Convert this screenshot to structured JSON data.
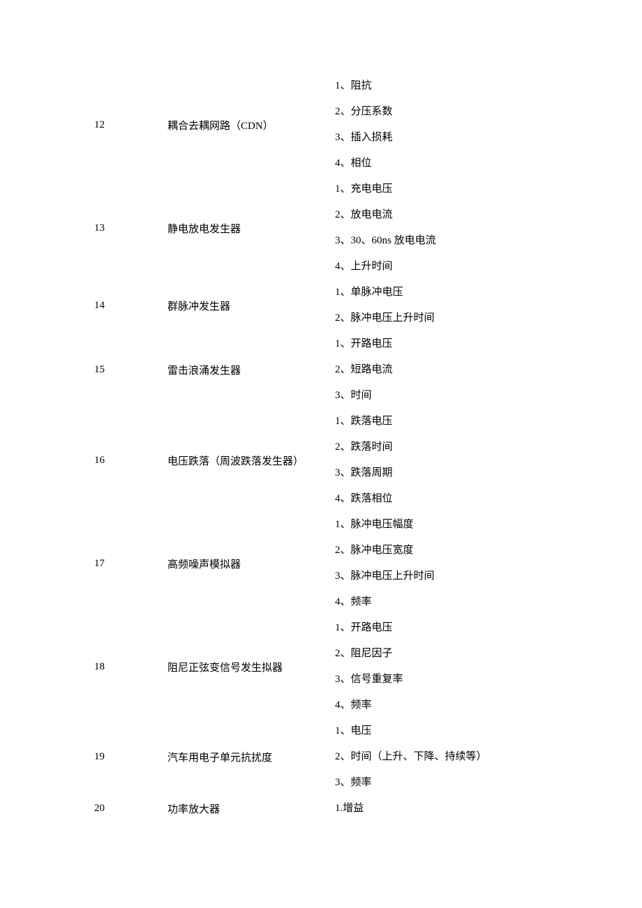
{
  "rows": [
    {
      "index": "12",
      "name": "耦合去耦网路（CDN）",
      "params": [
        "1、阻抗",
        "2、分压系数",
        "3、插入损耗",
        "4、相位"
      ]
    },
    {
      "index": "13",
      "name": "静电放电发生器",
      "params": [
        "1、充电电压",
        "2、放电电流",
        "3、30、60ns 放电电流",
        "4、上升时间"
      ]
    },
    {
      "index": "14",
      "name": "群脉冲发生器",
      "params": [
        "1、单脉冲电压",
        "2、脉冲电压上升时间"
      ]
    },
    {
      "index": "15",
      "name": "雷击浪涌发生器",
      "params": [
        "1、开路电压",
        "2、短路电流",
        "3、时间"
      ]
    },
    {
      "index": "16",
      "name": "电压跌落（周波跌落发生器）",
      "params": [
        "1、跌落电压",
        "2、跌落时间",
        "3、跌落周期",
        "4、跌落相位"
      ]
    },
    {
      "index": "17",
      "name": "高频噪声模拟器",
      "params": [
        "1、脉冲电压幅度",
        "2、脉冲电压宽度",
        "3、脉冲电压上升时间",
        "4、频率"
      ]
    },
    {
      "index": "18",
      "name": "阻尼正弦变信号发生拟器",
      "params": [
        "1、开路电压",
        "2、阻尼因子",
        "3、信号重复率",
        "4、频率"
      ]
    },
    {
      "index": "19",
      "name": "汽车用电子单元抗扰度",
      "params": [
        "1、电压",
        "2、时间（上升、下降、持续等）",
        "3、频率"
      ]
    },
    {
      "index": "20",
      "name": "功率放大器",
      "params": [
        "1.增益"
      ]
    }
  ]
}
